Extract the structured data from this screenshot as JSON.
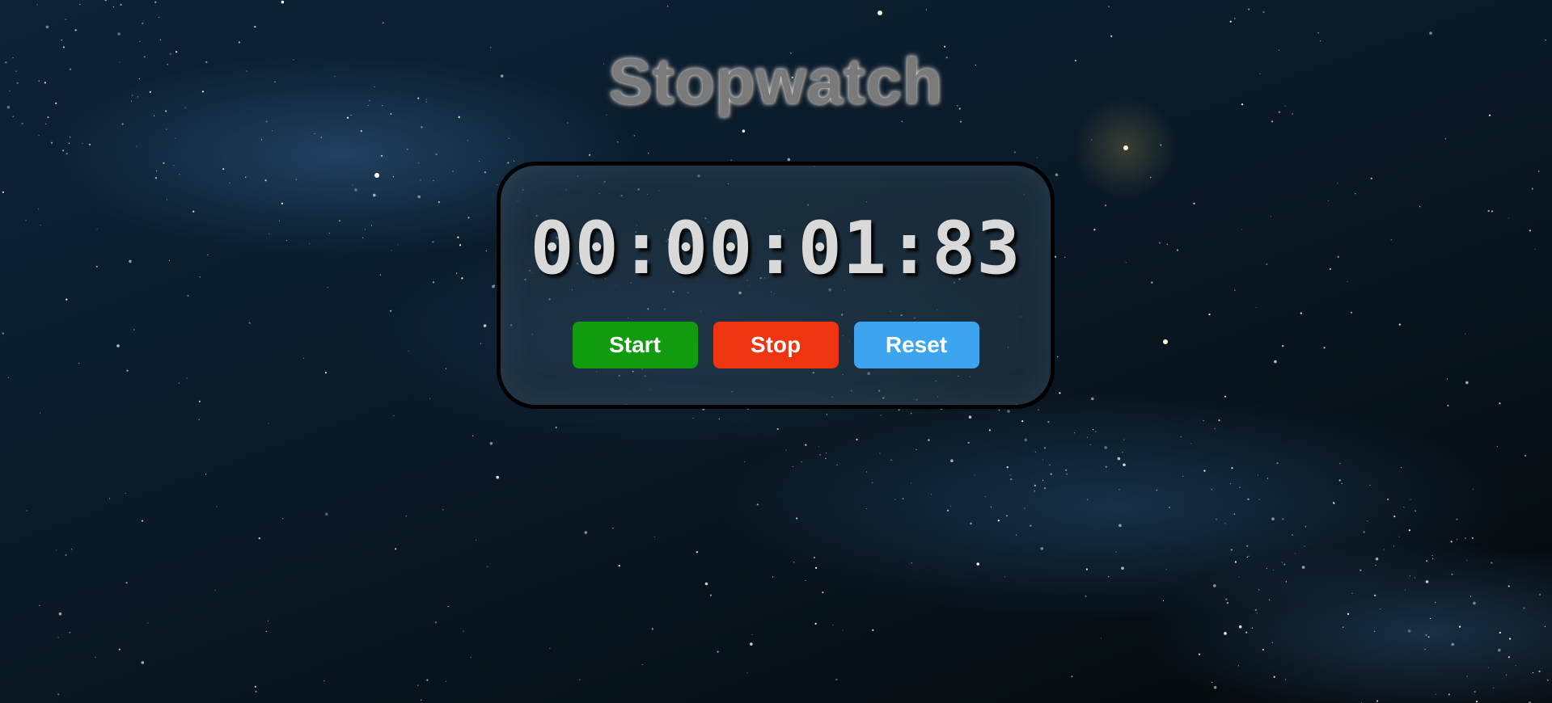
{
  "page": {
    "title": "Stopwatch"
  },
  "stopwatch": {
    "display": "00:00:01:83"
  },
  "controls": {
    "start_label": "Start",
    "stop_label": "Stop",
    "reset_label": "Reset"
  },
  "colors": {
    "start": "#119b0f",
    "stop": "#ef3510",
    "reset": "#3da5f0"
  }
}
